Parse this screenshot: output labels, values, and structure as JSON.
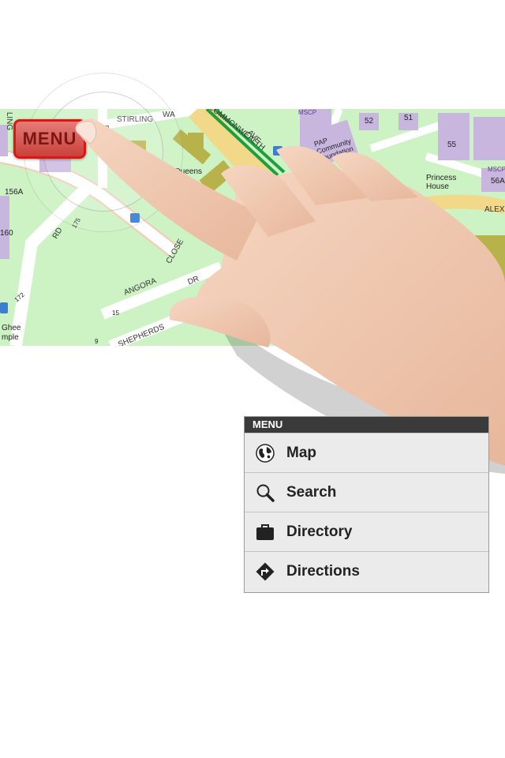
{
  "map": {
    "menu_button_label": "MENU",
    "road_labels": [
      "STIRLING",
      "WA",
      "COMMONWEALTH",
      "AVE",
      "ANGORA",
      "CLOSE",
      "SHEPHERDS",
      "DR",
      "RD",
      "LING",
      "RLING",
      "ALEX"
    ],
    "place_labels": [
      "Queens",
      "PAP Community Foundation",
      "Princess House",
      "MSCP",
      "MSCP"
    ],
    "block_numbers": [
      "52",
      "51",
      "55",
      "56A",
      "156A",
      "160",
      "175",
      "172",
      "15",
      "3",
      "9",
      "Ghee",
      "mple"
    ]
  },
  "menu": {
    "header": "MENU",
    "items": [
      {
        "label": "Map",
        "icon": "globe-icon"
      },
      {
        "label": "Search",
        "icon": "search-icon"
      },
      {
        "label": "Directory",
        "icon": "briefcase-icon"
      },
      {
        "label": "Directions",
        "icon": "directions-sign-icon"
      }
    ]
  },
  "colors": {
    "map_background": "#cdf2c4",
    "road": "#ffffff",
    "building_purple": "#c9b6df",
    "building_olive": "#b8b24a",
    "menu_button_red": "#e3140f",
    "menu_header": "#3a3a3a",
    "menu_background": "#ebebeb"
  }
}
